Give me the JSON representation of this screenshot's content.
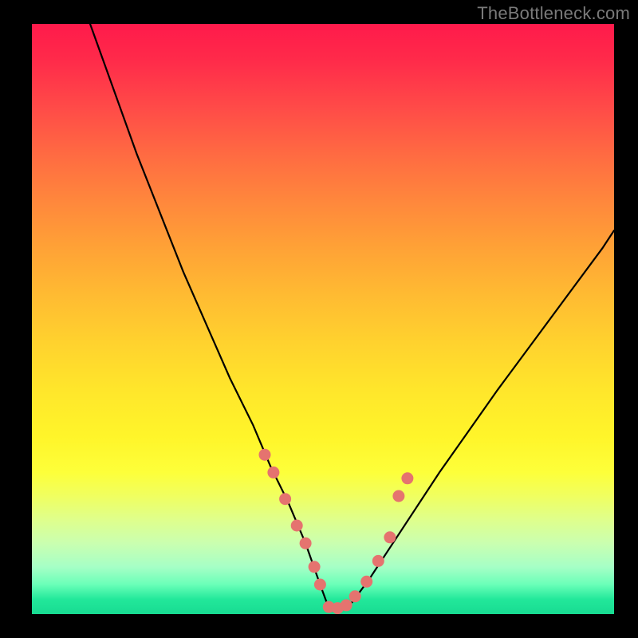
{
  "watermark": "TheBottleneck.com",
  "colors": {
    "background": "#000000",
    "curve_stroke": "#000000",
    "dot_fill": "#e5736f",
    "gradient_top": "#ff1a4b",
    "gradient_bottom": "#18db92"
  },
  "chart_data": {
    "type": "line",
    "title": "",
    "xlabel": "",
    "ylabel": "",
    "xlim": [
      0,
      100
    ],
    "ylim": [
      0,
      100
    ],
    "series": [
      {
        "name": "bottleneck-curve",
        "x": [
          10,
          14,
          18,
          22,
          26,
          30,
          34,
          38,
          41,
          44,
          47,
          49.5,
          51,
          53,
          55,
          58,
          62,
          66,
          70,
          75,
          80,
          86,
          92,
          98,
          100
        ],
        "values": [
          100,
          89,
          78,
          68,
          58,
          49,
          40,
          32,
          25,
          19,
          12,
          5,
          1,
          1,
          2,
          6,
          12,
          18,
          24,
          31,
          38,
          46,
          54,
          62,
          65
        ]
      }
    ],
    "markers": {
      "name": "highlight-dots",
      "x": [
        40.0,
        41.5,
        43.5,
        45.5,
        47.0,
        48.5,
        49.5,
        51.0,
        52.5,
        54.0,
        55.5,
        57.5,
        59.5,
        61.5,
        63.0,
        64.5
      ],
      "values": [
        27.0,
        24.0,
        19.5,
        15.0,
        12.0,
        8.0,
        5.0,
        1.2,
        1.0,
        1.5,
        3.0,
        5.5,
        9.0,
        13.0,
        20.0,
        23.0
      ]
    }
  }
}
